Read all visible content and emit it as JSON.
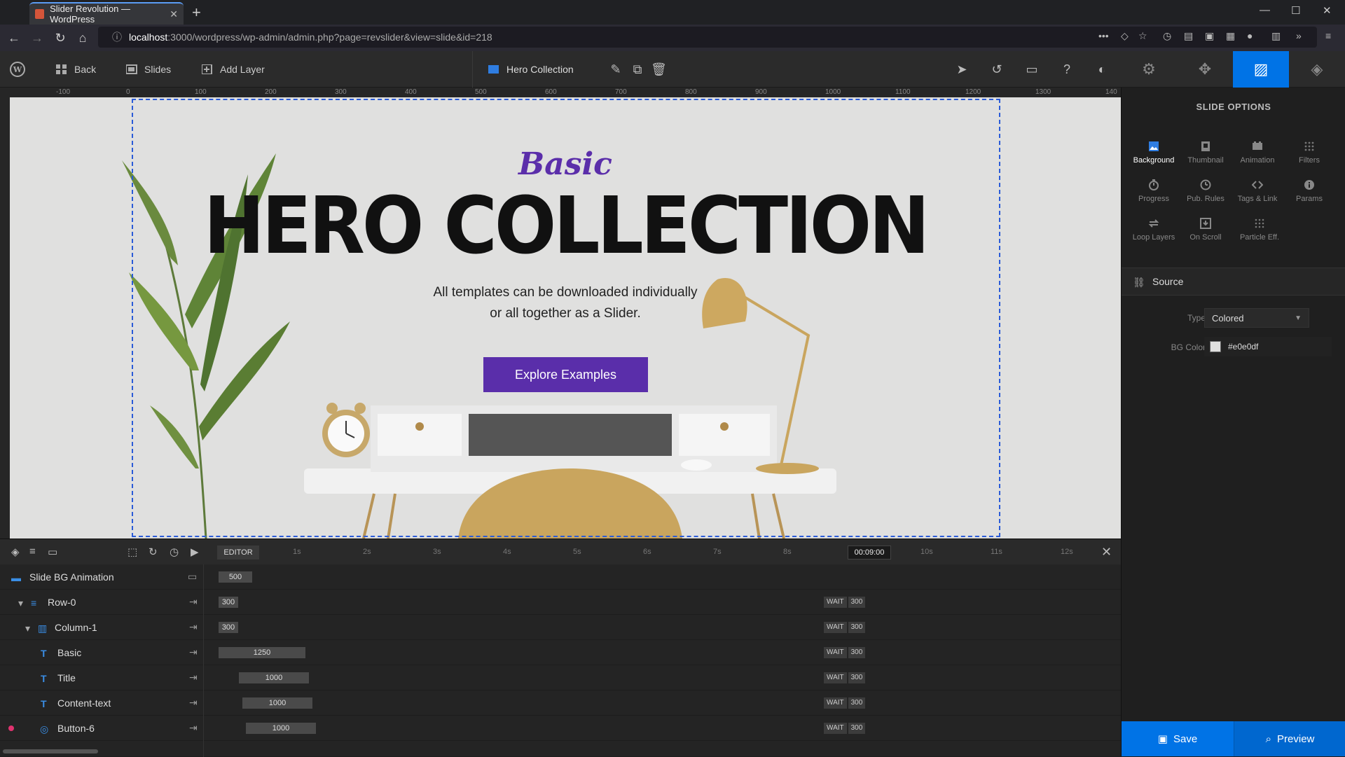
{
  "browser": {
    "tab_title": "Slider Revolution — WordPress",
    "url_host": "localhost",
    "url_path": ":3000/wordpress/wp-admin/admin.php?page=revslider&view=slide&id=218"
  },
  "toolbar": {
    "back_label": "Back",
    "slides_label": "Slides",
    "add_layer_label": "Add Layer",
    "slider_title": "Hero Collection"
  },
  "ruler": {
    "marks": [
      "-100",
      "0",
      "100",
      "200",
      "300",
      "400",
      "500",
      "600",
      "700",
      "800",
      "900",
      "1000",
      "1100",
      "1200",
      "1300",
      "140"
    ]
  },
  "canvas": {
    "background_color": "#e0e0df",
    "basic_text": "Basic",
    "heading": "HERO COLLECTION",
    "content_line1": "All templates can be downloaded individually",
    "content_line2": "or all together as a Slider.",
    "button_label": "Explore Examples"
  },
  "timeline": {
    "editor_label": "EDITOR",
    "ticks": [
      "1s",
      "2s",
      "3s",
      "4s",
      "5s",
      "6s",
      "7s",
      "8s",
      "10s",
      "11s",
      "12s"
    ],
    "time_readout": "00:09:00",
    "rows": [
      {
        "label": "Slide BG Animation",
        "duration": "500",
        "wait": "",
        "wait_value": ""
      },
      {
        "label": "Row-0",
        "duration": "300",
        "wait": "WAIT",
        "wait_value": "300"
      },
      {
        "label": "Column-1",
        "duration": "300",
        "wait": "WAIT",
        "wait_value": "300"
      },
      {
        "label": "Basic",
        "duration": "1250",
        "wait": "WAIT",
        "wait_value": "300"
      },
      {
        "label": "Title",
        "duration": "1000",
        "wait": "WAIT",
        "wait_value": "300"
      },
      {
        "label": "Content-text",
        "duration": "1000",
        "wait": "WAIT",
        "wait_value": "300"
      },
      {
        "label": "Button-6",
        "duration": "1000",
        "wait": "WAIT",
        "wait_value": "300"
      }
    ]
  },
  "panel": {
    "title": "SLIDE OPTIONS",
    "options": [
      {
        "label": "Background",
        "icon": "image-icon"
      },
      {
        "label": "Thumbnail",
        "icon": "thumbnail-icon"
      },
      {
        "label": "Animation",
        "icon": "film-icon"
      },
      {
        "label": "Filters",
        "icon": "grid-icon"
      },
      {
        "label": "Progress",
        "icon": "timer-icon"
      },
      {
        "label": "Pub. Rules",
        "icon": "clock-icon"
      },
      {
        "label": "Tags & Link",
        "icon": "code-icon"
      },
      {
        "label": "Params",
        "icon": "info-icon"
      },
      {
        "label": "Loop Layers",
        "icon": "loop-icon"
      },
      {
        "label": "On Scroll",
        "icon": "download-icon"
      },
      {
        "label": "Particle Eff.",
        "icon": "particle-icon"
      }
    ],
    "section_label": "Source",
    "type_label": "Type",
    "type_value": "Colored",
    "bgcolor_label": "BG Color",
    "bgcolor_value": "#e0e0df",
    "save_label": "Save",
    "preview_label": "Preview"
  }
}
